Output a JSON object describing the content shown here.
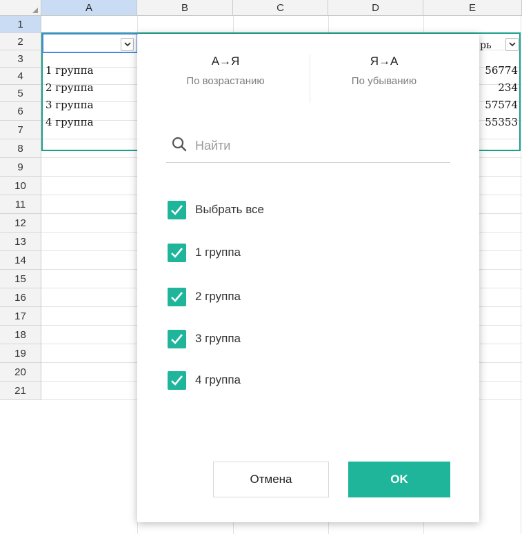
{
  "sheet": {
    "columns": [
      "A",
      "B",
      "C",
      "D",
      "E"
    ],
    "rows": [
      "1",
      "2",
      "3",
      "4",
      "5",
      "6",
      "7",
      "8",
      "9",
      "10",
      "11",
      "12",
      "13",
      "14",
      "15",
      "16",
      "17",
      "18",
      "19",
      "20",
      "21"
    ],
    "col_a_cells": [
      "1 группа",
      "2 группа",
      "3 группа",
      "4 группа"
    ],
    "col_e_header_partial": "рь",
    "col_e_cells": [
      "56774",
      "234",
      "57574",
      "55353"
    ]
  },
  "filter_popup": {
    "sort_asc": {
      "label": "А→Я",
      "sublabel": "По возрастанию"
    },
    "sort_desc": {
      "label": "Я→А",
      "sublabel": "По убыванию"
    },
    "search_placeholder": "Найти",
    "select_all_label": "Выбрать все",
    "options": [
      "1 группа",
      "2 группа",
      "3 группа",
      "4 группа"
    ],
    "cancel_label": "Отмена",
    "ok_label": "OK"
  },
  "colors": {
    "accent": "#1fb59b",
    "selection_border": "#1aa18a",
    "active_cell": "#4a88d8"
  }
}
